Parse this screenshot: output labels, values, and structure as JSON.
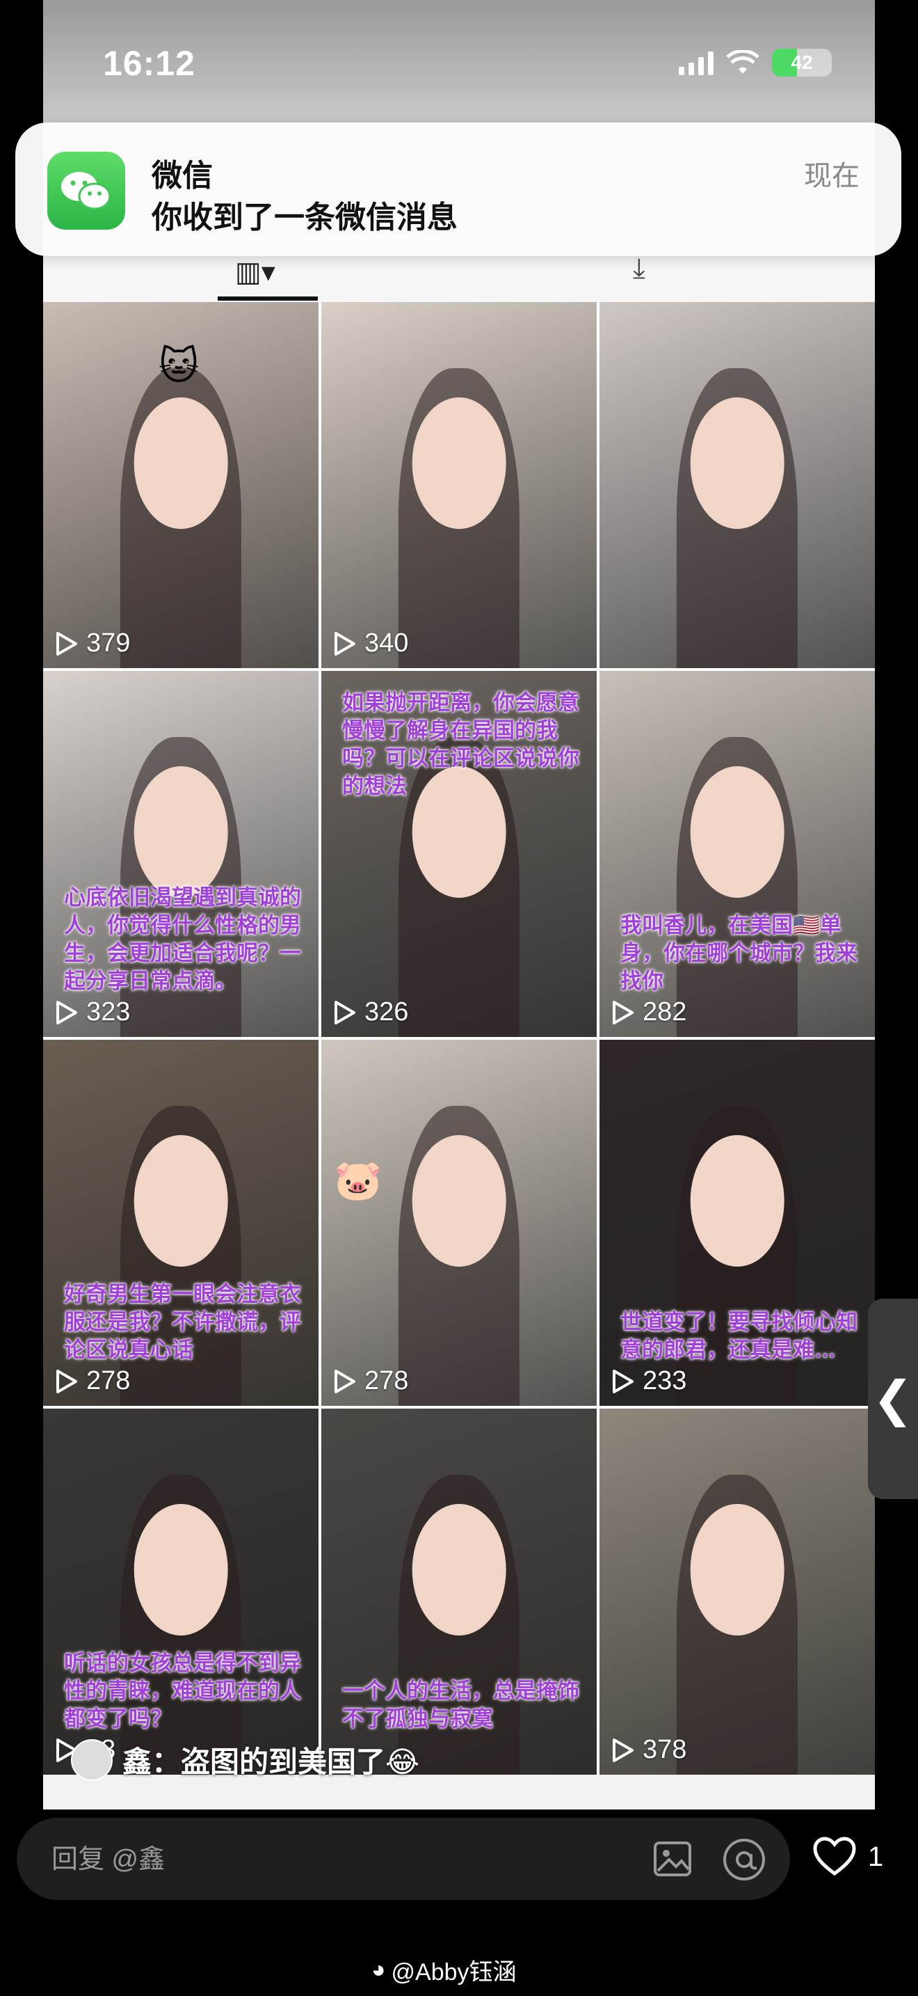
{
  "status_bar": {
    "time": "16:12",
    "battery": "42"
  },
  "notification": {
    "app": "微信",
    "message": "你收到了一条微信消息",
    "time": "现在"
  },
  "grid": [
    {
      "views": "379",
      "caption": "",
      "bg": "#c9bcb2",
      "sticker": "🐱"
    },
    {
      "views": "340",
      "caption": "",
      "bg": "#d9cfc6"
    },
    {
      "views": "",
      "caption": "",
      "bg": "#cfc8c4"
    },
    {
      "views": "323",
      "caption": "心底依旧渴望遇到真诚的人，你觉得什么性格的男生，会更加适合我呢？一起分享日常点滴。",
      "bg": "#d8d2ce"
    },
    {
      "views": "326",
      "caption": "如果抛开距离，你会愿意慢慢了解身在异国的我吗？可以在评论区说说你的想法",
      "caption_top": true,
      "bg": "#6b6560"
    },
    {
      "views": "282",
      "caption": "我叫香儿，在美国🇺🇸单身，你在哪个城市？我来找你",
      "bg": "#c7bfb8"
    },
    {
      "views": "278",
      "caption": "好奇男生第一眼会注意衣服还是我？不许撒谎，评论区说真心话",
      "bg": "#6a5e52"
    },
    {
      "views": "278",
      "caption": "",
      "bg": "#cfc7be",
      "sticker": "🐷"
    },
    {
      "views": "233",
      "caption": "世道变了！要寻找倾心知意的郎君，还真是难…",
      "bg": "#2e2628"
    },
    {
      "views": "23",
      "caption": "听话的女孩总是得不到异性的青睐，难道现在的人都变了吗？",
      "bg": "#3a3634"
    },
    {
      "views": "",
      "caption": "一个人的生活，总是掩饰不了孤独与寂寞",
      "bg": "#4b4744"
    },
    {
      "views": "378",
      "caption": "",
      "bg": "#8e877c"
    }
  ],
  "comment": {
    "user": "鑫",
    "text": "鑫：盗图的到美国了😂"
  },
  "reply_bar": {
    "placeholder": "回复 @鑫",
    "like_count": "1"
  },
  "side_handle": "❮",
  "watermark": "@Abby钰涵",
  "icons": [
    "wechat-icon",
    "play-icon",
    "image-icon",
    "at-icon",
    "heart-icon",
    "weibo-icon",
    "grid-tab-icon",
    "like-tab-icon"
  ]
}
